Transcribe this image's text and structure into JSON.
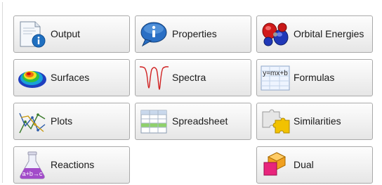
{
  "tiles": {
    "output": {
      "label": "Output",
      "icon": "output-document-info-icon"
    },
    "properties": {
      "label": "Properties",
      "icon": "properties-info-bubble-icon"
    },
    "orbital_energies": {
      "label": "Orbital Energies",
      "icon": "orbital-lobes-icon"
    },
    "surfaces": {
      "label": "Surfaces",
      "icon": "surface-map-icon"
    },
    "spectra": {
      "label": "Spectra",
      "icon": "spectrum-curve-icon"
    },
    "formulas": {
      "label": "Formulas",
      "icon": "formula-sheet-icon",
      "icon_text": "y=mx+b"
    },
    "plots": {
      "label": "Plots",
      "icon": "line-plot-icon"
    },
    "spreadsheet": {
      "label": "Spreadsheet",
      "icon": "spreadsheet-icon"
    },
    "similarities": {
      "label": "Similarities",
      "icon": "puzzle-pieces-icon"
    },
    "reactions": {
      "label": "Reactions",
      "icon": "reaction-flask-icon",
      "icon_text": "a+b→c"
    },
    "dual": {
      "label": "Dual",
      "icon": "dual-shapes-icon"
    }
  },
  "colors": {
    "tile_border": "#a9a9a9",
    "tile_top": "#fdfdfd",
    "tile_bottom": "#e6e6e6",
    "info_blue": "#1f6fc0",
    "orbital_red": "#d11a1a",
    "orbital_blue": "#2038b8",
    "spectrum_red": "#d02020",
    "sheet_green": "#8fd16a",
    "puzzle_yellow": "#f2c200",
    "flask_purple": "#a24bc9",
    "dual_pink": "#e8247c",
    "dual_orange": "#f0a020"
  }
}
